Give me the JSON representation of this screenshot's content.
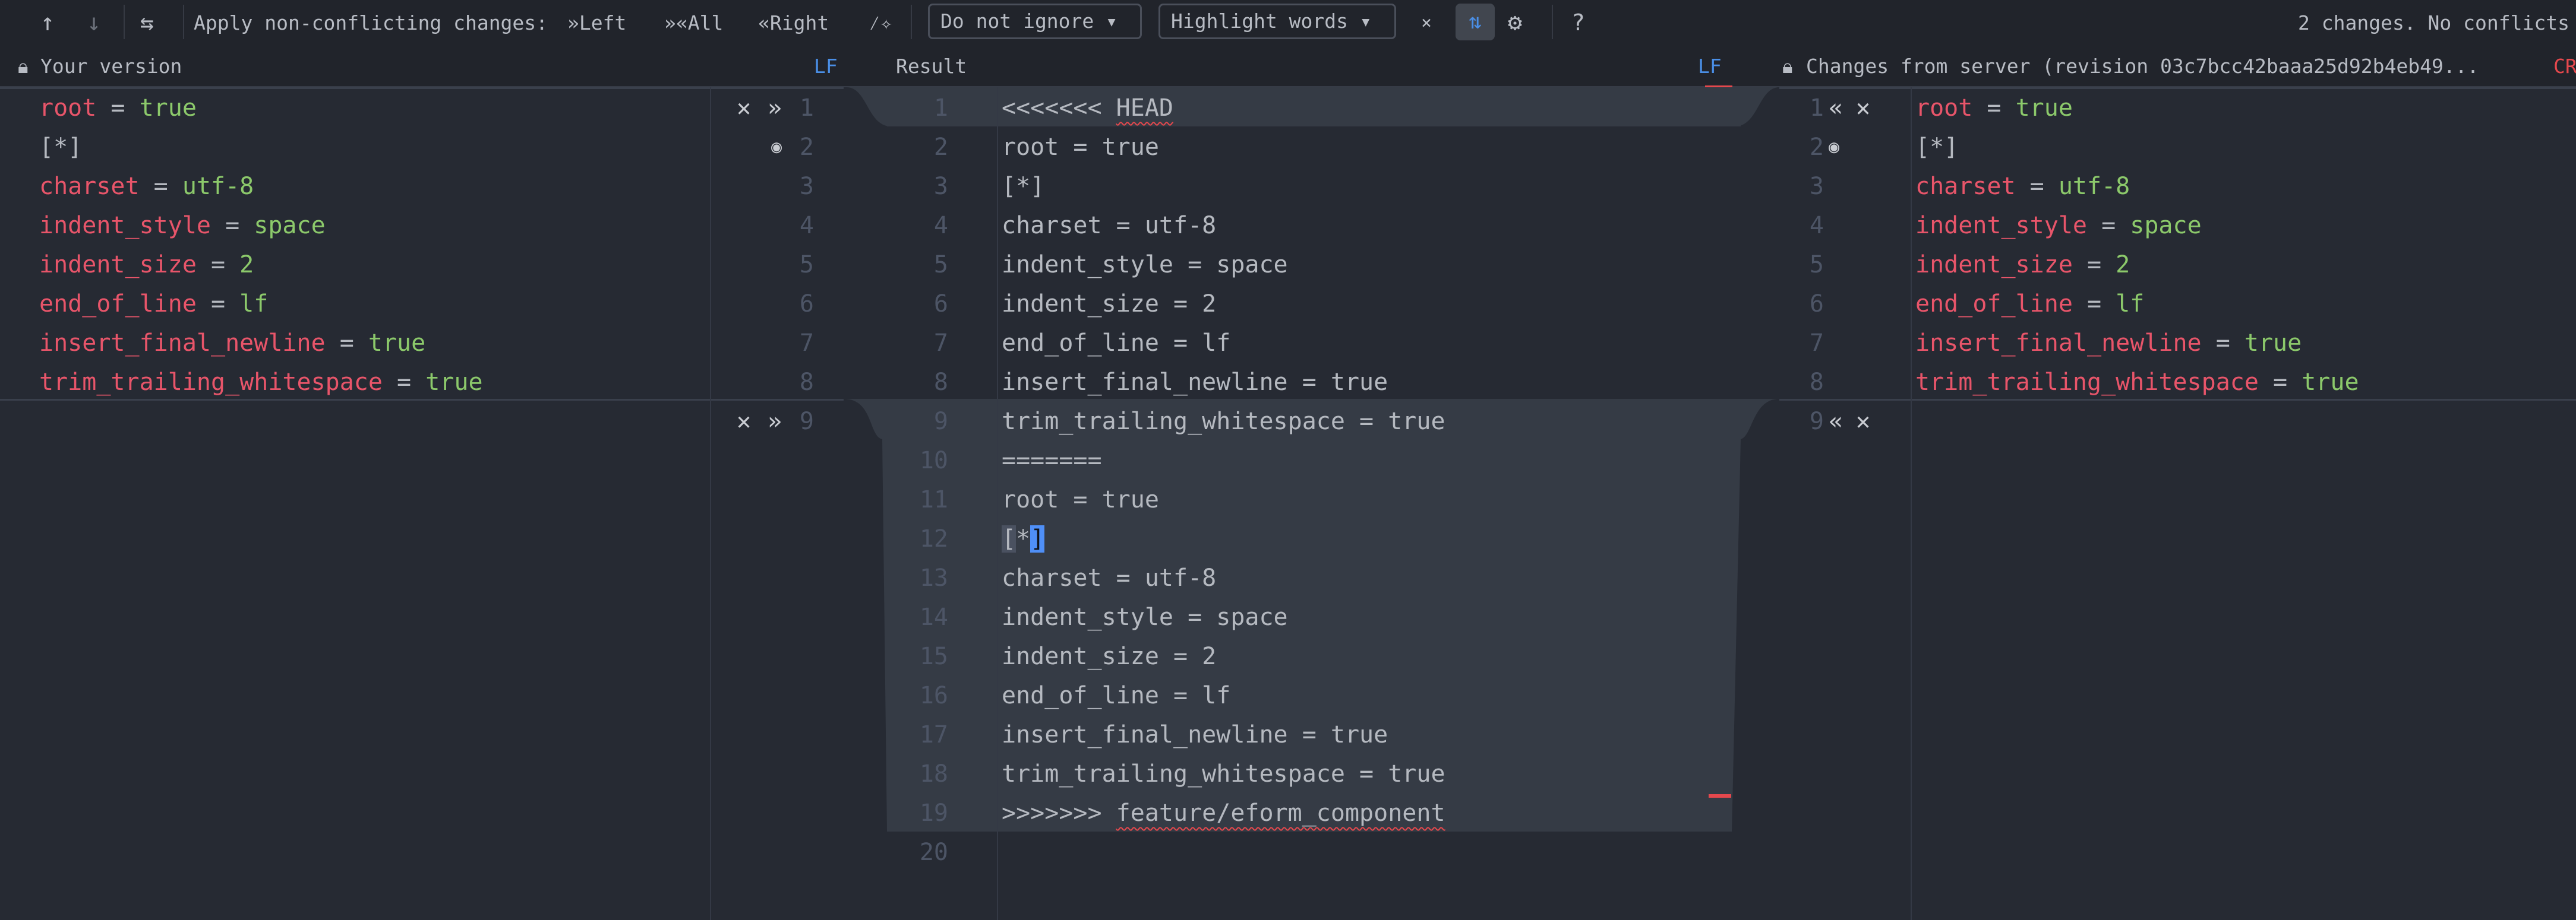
{
  "toolbar": {
    "prev_icon": "arrow-up-icon",
    "next_icon": "arrow-down-icon",
    "merge_icon": "apply-changes-icon",
    "apply_label": "Apply non-conflicting changes:",
    "left_label": "»Left",
    "all_label": "»«All",
    "right_label": "«Right",
    "magic_icon": "magic-resolve-icon",
    "ignore_select": "Do not ignore",
    "highlight_select": "Highlight words",
    "collapse_icon": "collapse-unchanged-icon",
    "sync_scroll_icon": "sync-scroll-icon",
    "settings_icon": "gear-icon",
    "help_label": "?",
    "status": "2 changes. No conflicts"
  },
  "header": {
    "left_title": "Your version",
    "left_eol": "LF",
    "middle_title": "Result",
    "middle_eol": "LF",
    "right_title": "Changes from server (revision 03c7bcc42baaa25d92b4eb49...",
    "right_eol": "CR"
  },
  "colors": {
    "key": "#e8556a",
    "value": "#8cc96b",
    "accent": "#4a8fe7",
    "error": "#e5484d",
    "conflict_bg": "#353b45"
  },
  "left_panel": {
    "lines": [
      "root = true",
      "[*]",
      "charset = utf-8",
      "indent_style = space",
      "indent_size = 2",
      "end_of_line = lf",
      "insert_final_newline = true",
      "trim_trailing_whitespace = true"
    ],
    "line_numbers": [
      "1",
      "2",
      "3",
      "4",
      "5",
      "6",
      "7",
      "8",
      "9"
    ]
  },
  "result_panel": {
    "lines": [
      "<<<<<<< HEAD",
      "root = true",
      "[*]",
      "charset = utf-8",
      "indent_style = space",
      "indent_size = 2",
      "end_of_line = lf",
      "insert_final_newline = true",
      "trim_trailing_whitespace = true",
      "=======",
      "root = true",
      "[*]",
      "charset = utf-8",
      "indent_style = space",
      "indent_size = 2",
      "end_of_line = lf",
      "insert_final_newline = true",
      "trim_trailing_whitespace = true",
      ">>>>>>> feature/eform_component",
      ""
    ],
    "line_numbers": [
      "1",
      "2",
      "3",
      "4",
      "5",
      "6",
      "7",
      "8",
      "9",
      "10",
      "11",
      "12",
      "13",
      "14",
      "15",
      "16",
      "17",
      "18",
      "19",
      "20"
    ]
  },
  "right_panel": {
    "lines": [
      "root = true",
      "[*]",
      "charset = utf-8",
      "indent_style = space",
      "indent_size = 2",
      "end_of_line = lf",
      "insert_final_newline = true",
      "trim_trailing_whitespace = true"
    ],
    "line_numbers": [
      "1",
      "2",
      "3",
      "4",
      "5",
      "6",
      "7",
      "8",
      "9"
    ]
  }
}
